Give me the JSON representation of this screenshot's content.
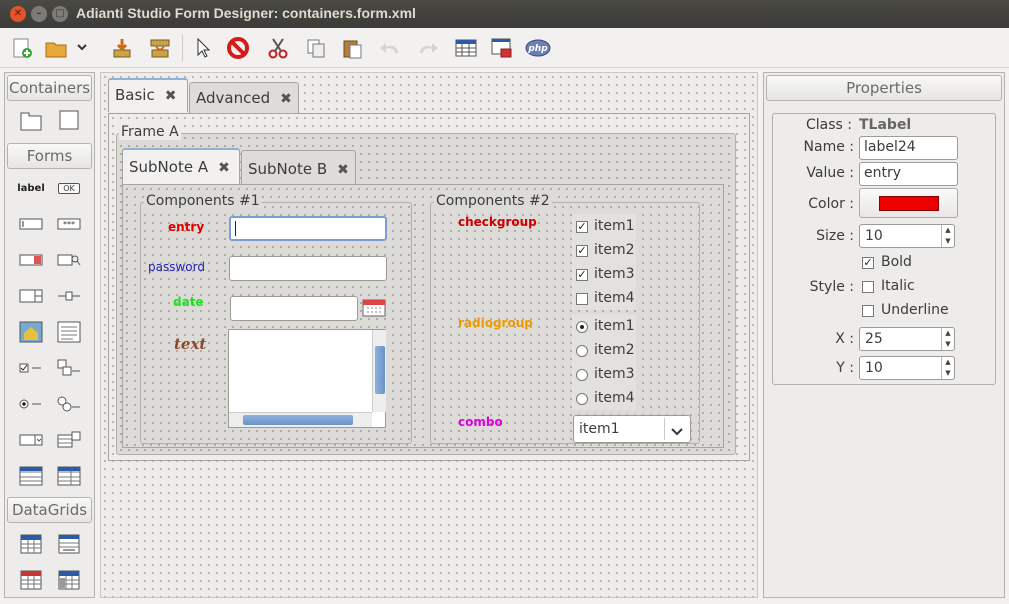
{
  "window": {
    "title": "Adianti Studio Form Designer: containers.form.xml"
  },
  "toolbar": {
    "icons": [
      "new-file-icon",
      "open-folder-icon",
      "dropdown-arrow-icon",
      "save-icon",
      "save-as-icon",
      "pointer-icon",
      "stop-icon",
      "cut-icon",
      "copy-icon",
      "paste-icon",
      "undo-icon",
      "redo-icon",
      "grid-icon",
      "preview-icon",
      "php-icon"
    ],
    "php_text": "php"
  },
  "palette": {
    "containers_header": "Containers",
    "forms_header": "Forms",
    "datagrids_header": "DataGrids",
    "label_icon_text": "label",
    "ok_icon_text": "OK"
  },
  "tabs": [
    {
      "label": "Basic",
      "active": true
    },
    {
      "label": "Advanced",
      "active": false
    }
  ],
  "frame_a": {
    "title": "Frame A"
  },
  "subtabs": [
    {
      "label": "SubNote A",
      "active": true
    },
    {
      "label": "SubNote B",
      "active": false
    }
  ],
  "components1": {
    "title": "Components #1",
    "entry_label": "entry",
    "password_label": "password",
    "date_label": "date",
    "text_label": "text"
  },
  "components2": {
    "title": "Components #2",
    "checkgroup_label": "checkgroup",
    "checkgroup_items": [
      {
        "label": "item1",
        "checked": true
      },
      {
        "label": "item2",
        "checked": true
      },
      {
        "label": "item3",
        "checked": true
      },
      {
        "label": "item4",
        "checked": false
      }
    ],
    "radiogroup_label": "radiogroup",
    "radiogroup_items": [
      {
        "label": "item1",
        "selected": true
      },
      {
        "label": "item2",
        "selected": false
      },
      {
        "label": "item3",
        "selected": false
      },
      {
        "label": "item4",
        "selected": false
      }
    ],
    "combo_label": "combo",
    "combo_value": "item1"
  },
  "properties": {
    "header": "Properties",
    "class_label": "Class :",
    "class_value": "TLabel",
    "name_label": "Name :",
    "name_value": "label24",
    "value_label": "Value :",
    "value_value": "entry",
    "color_label": "Color :",
    "color_value": "#ee0000",
    "size_label": "Size :",
    "size_value": "10",
    "style_label": "Style :",
    "bold_label": "Bold",
    "bold_checked": true,
    "italic_label": "Italic",
    "italic_checked": false,
    "underline_label": "Underline",
    "underline_checked": false,
    "x_label": "X :",
    "x_value": "25",
    "y_label": "Y :",
    "y_value": "10"
  },
  "colors": {
    "entry": "#e00000",
    "password": "#2020b0",
    "date": "#22dd22",
    "text": "#8b4a2b",
    "checkgroup": "#cc0000",
    "radiogroup": "#ee9900",
    "combo": "#dd00dd"
  }
}
